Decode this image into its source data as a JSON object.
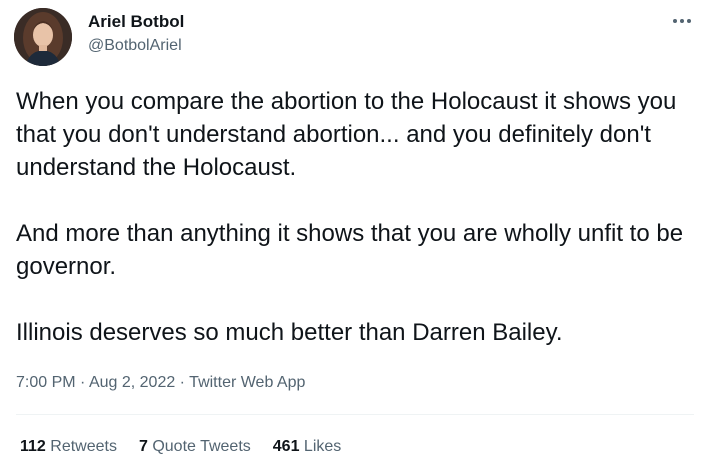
{
  "author": {
    "display_name": "Ariel Botbol",
    "handle": "@BotbolAriel",
    "avatar_icon": "profile-photo"
  },
  "menu": {
    "icon": "more-options-icon"
  },
  "tweet": {
    "paragraphs": [
      "When you compare the abortion to the Holocaust it shows you that you don't understand abortion... and you definitely don't understand the Holocaust.",
      "And more than anything it shows that you are wholly unfit to be governor.",
      "Illinois deserves so much better than Darren Bailey."
    ]
  },
  "meta": {
    "time": "7:00 PM",
    "separator": " · ",
    "date": "Aug 2, 2022",
    "source": "Twitter Web App"
  },
  "stats": {
    "retweets_count": "112",
    "retweets_label": "Retweets",
    "quote_count": "7",
    "quote_label": "Quote Tweets",
    "likes_count": "461",
    "likes_label": "Likes"
  },
  "colors": {
    "text_primary": "#0f1419",
    "text_secondary": "#536471",
    "divider": "#eff3f4"
  }
}
